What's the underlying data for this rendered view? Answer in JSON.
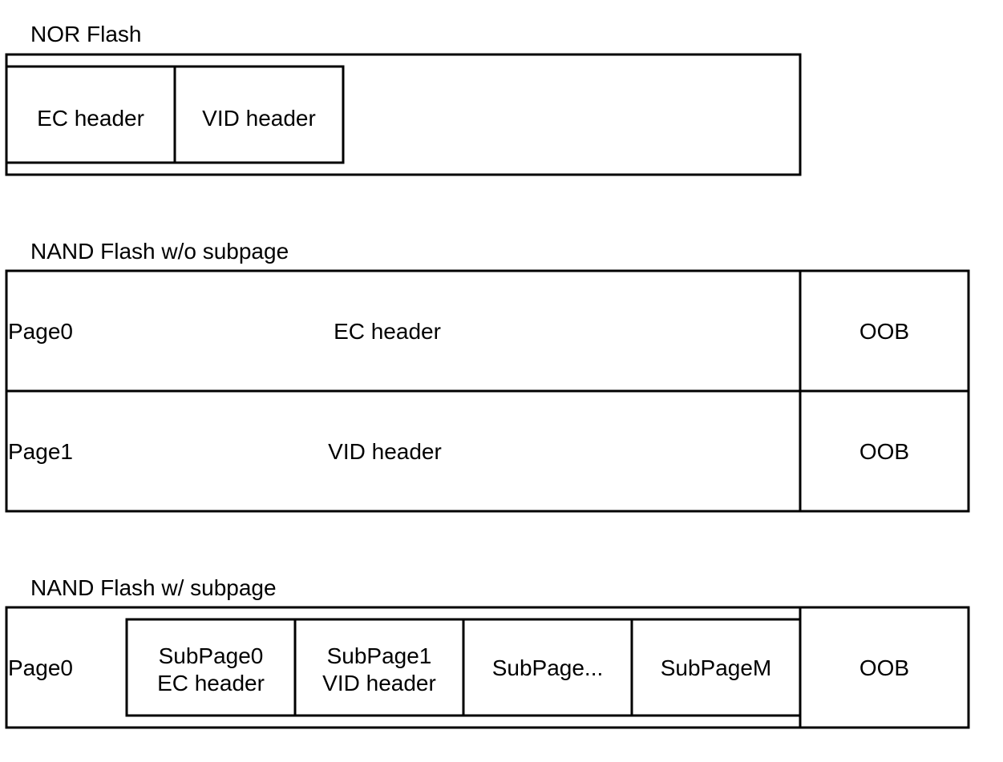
{
  "nor": {
    "title": "NOR Flash",
    "cells": [
      "EC header",
      "VID header"
    ]
  },
  "nand_no_subpage": {
    "title": "NAND Flash w/o subpage",
    "rows": [
      {
        "page": "Page0",
        "content": "EC header",
        "oob": "OOB"
      },
      {
        "page": "Page1",
        "content": "VID header",
        "oob": "OOB"
      }
    ]
  },
  "nand_subpage": {
    "title": "NAND Flash w/ subpage",
    "page": "Page0",
    "subpages": [
      {
        "line1": "SubPage0",
        "line2": "EC header"
      },
      {
        "line1": "SubPage1",
        "line2": "VID header"
      },
      {
        "line1": "SubPage...",
        "line2": ""
      },
      {
        "line1": "SubPageM",
        "line2": ""
      }
    ],
    "oob": "OOB"
  }
}
